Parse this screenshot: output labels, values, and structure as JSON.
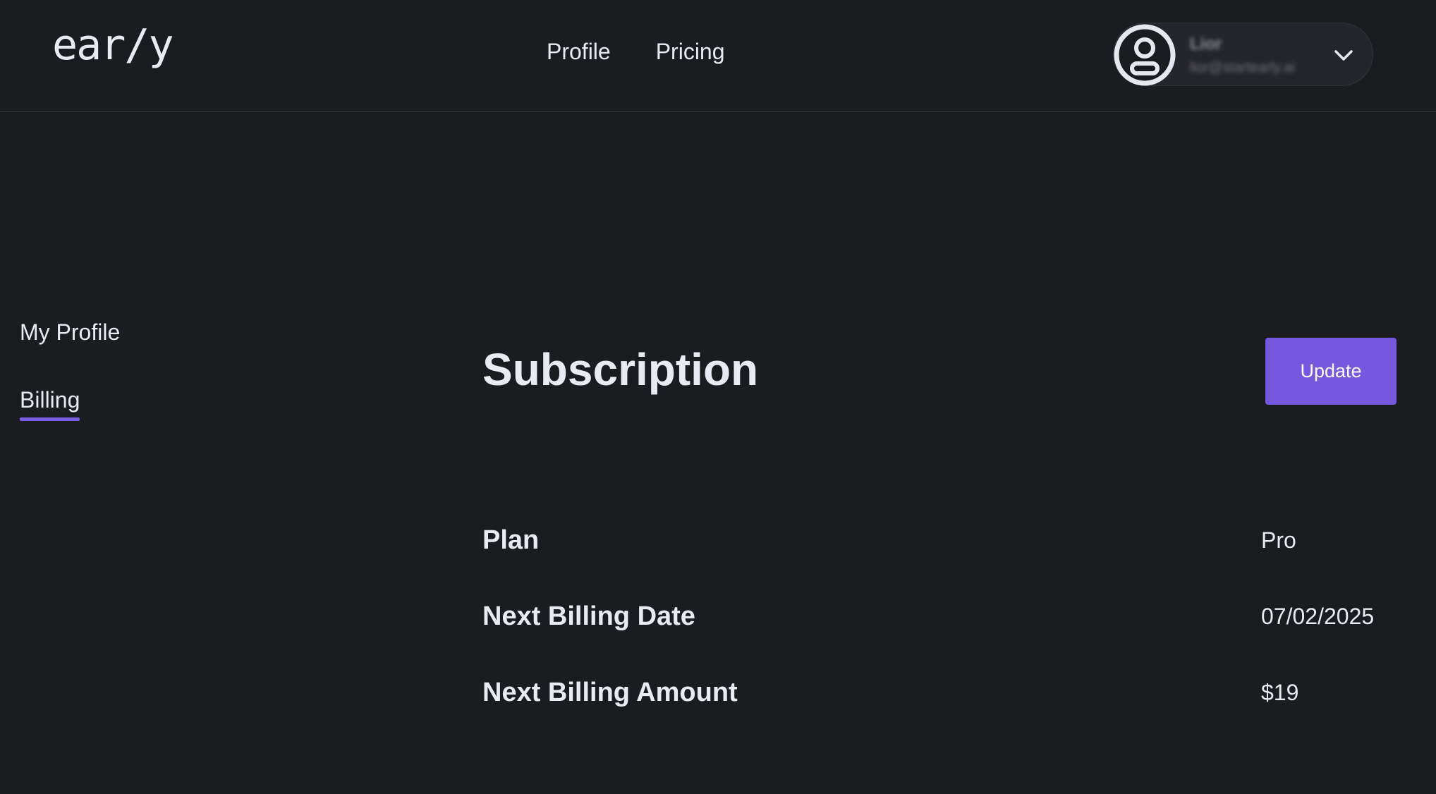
{
  "header": {
    "logo": "ear/y",
    "nav": [
      {
        "label": "Profile"
      },
      {
        "label": "Pricing"
      }
    ],
    "user": {
      "name": "Lior",
      "email": "lior@startearly.ai",
      "avatar_icon": "user-circle-icon",
      "dropdown_icon": "chevron-down-icon"
    }
  },
  "sidebar": {
    "items": [
      {
        "label": "My Profile",
        "active": false
      },
      {
        "label": "Billing",
        "active": true
      }
    ]
  },
  "main": {
    "title": "Subscription",
    "update_label": "Update",
    "rows": [
      {
        "label": "Plan",
        "value": "Pro"
      },
      {
        "label": "Next Billing Date",
        "value": "07/02/2025"
      },
      {
        "label": "Next Billing Amount",
        "value": "$19"
      }
    ]
  },
  "colors": {
    "background": "#1b1c20",
    "accent": "#7557e0",
    "text": "#e9ebf3"
  }
}
